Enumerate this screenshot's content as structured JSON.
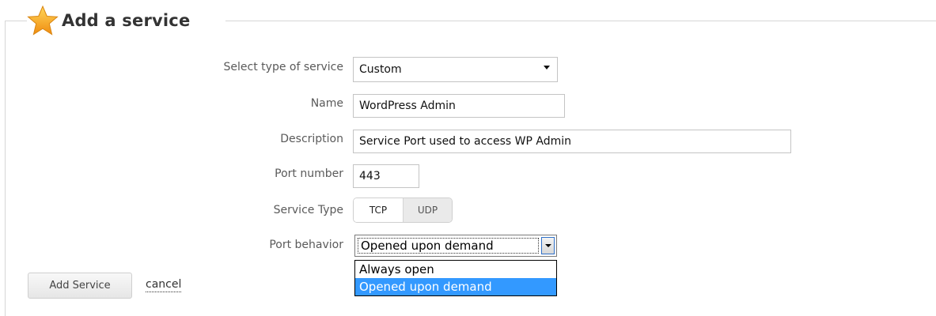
{
  "section": {
    "title": "Add a service",
    "icon": "star-icon"
  },
  "form": {
    "type_label": "Select type of service",
    "type_value": "Custom",
    "name_label": "Name",
    "name_value": "WordPress Admin",
    "description_label": "Description",
    "description_value": "Service Port used to access WP Admin",
    "port_label": "Port number",
    "port_value": "443",
    "service_type_label": "Service Type",
    "service_type_options": [
      "TCP",
      "UDP"
    ],
    "service_type_selected": "TCP",
    "behavior_label": "Port behavior",
    "behavior_value": "Opened upon demand",
    "behavior_options": [
      "Always open",
      "Opened upon demand"
    ],
    "behavior_highlighted": "Opened upon demand"
  },
  "actions": {
    "submit_label": "Add Service",
    "cancel_label": "cancel"
  },
  "colors": {
    "star": "#f7a81b",
    "highlight": "#3399ff",
    "border": "#c4c4c4"
  }
}
